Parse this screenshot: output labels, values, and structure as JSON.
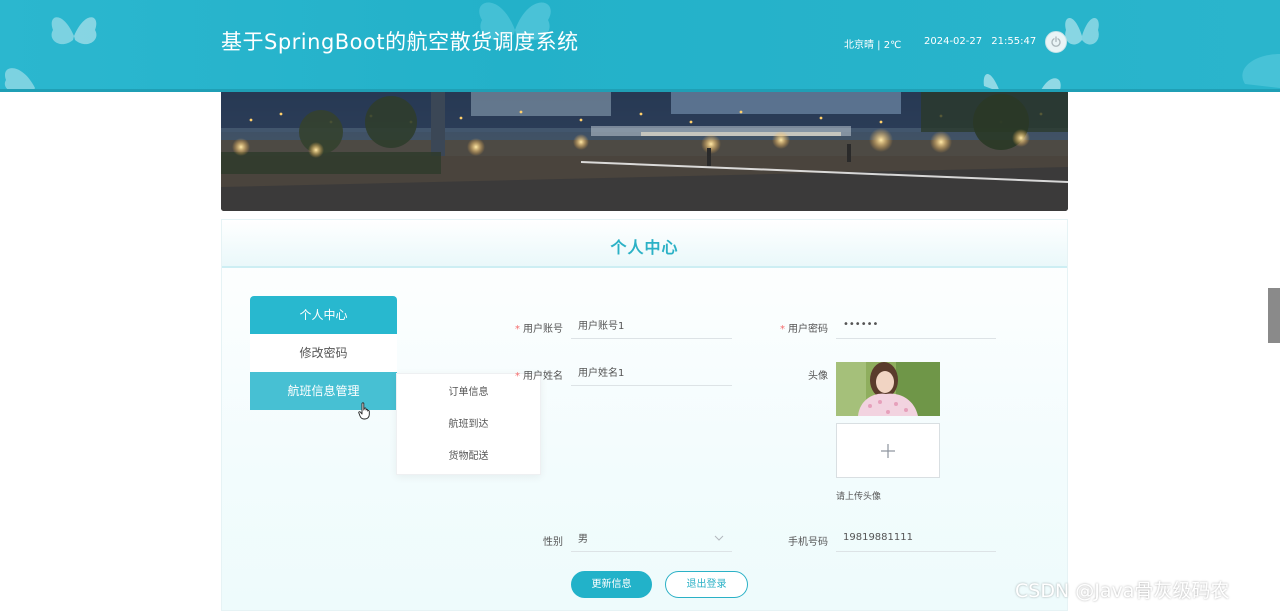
{
  "header": {
    "title": "基于SpringBoot的航空散货调度系统",
    "weather": "北京晴 | 2℃",
    "datetime": "2024-02-27  21:55:47",
    "power_icon": "power-icon",
    "background_color": "#2bb7cf"
  },
  "panel": {
    "title": "个人中心",
    "accent_color": "#2bb1c6"
  },
  "side_menu": {
    "items": [
      {
        "label": "个人中心"
      },
      {
        "label": "修改密码"
      },
      {
        "label": "航班信息管理"
      }
    ],
    "submenu": [
      {
        "label": "订单信息"
      },
      {
        "label": "航班到达"
      },
      {
        "label": "货物配送"
      }
    ]
  },
  "form": {
    "username": {
      "label": "用户账号",
      "value": "用户账号1"
    },
    "password": {
      "label": "用户密码",
      "value": "••••••"
    },
    "name": {
      "label": "用户姓名",
      "value": "用户姓名1"
    },
    "avatar": {
      "label": "头像",
      "upload_hint": "请上传头像"
    },
    "gender": {
      "label": "性别",
      "value": "男"
    },
    "phone": {
      "label": "手机号码",
      "value": "19819881111"
    },
    "update_button": "更新信息",
    "logout_button": "退出登录"
  },
  "watermark": "CSDN @Java骨灰级码农"
}
